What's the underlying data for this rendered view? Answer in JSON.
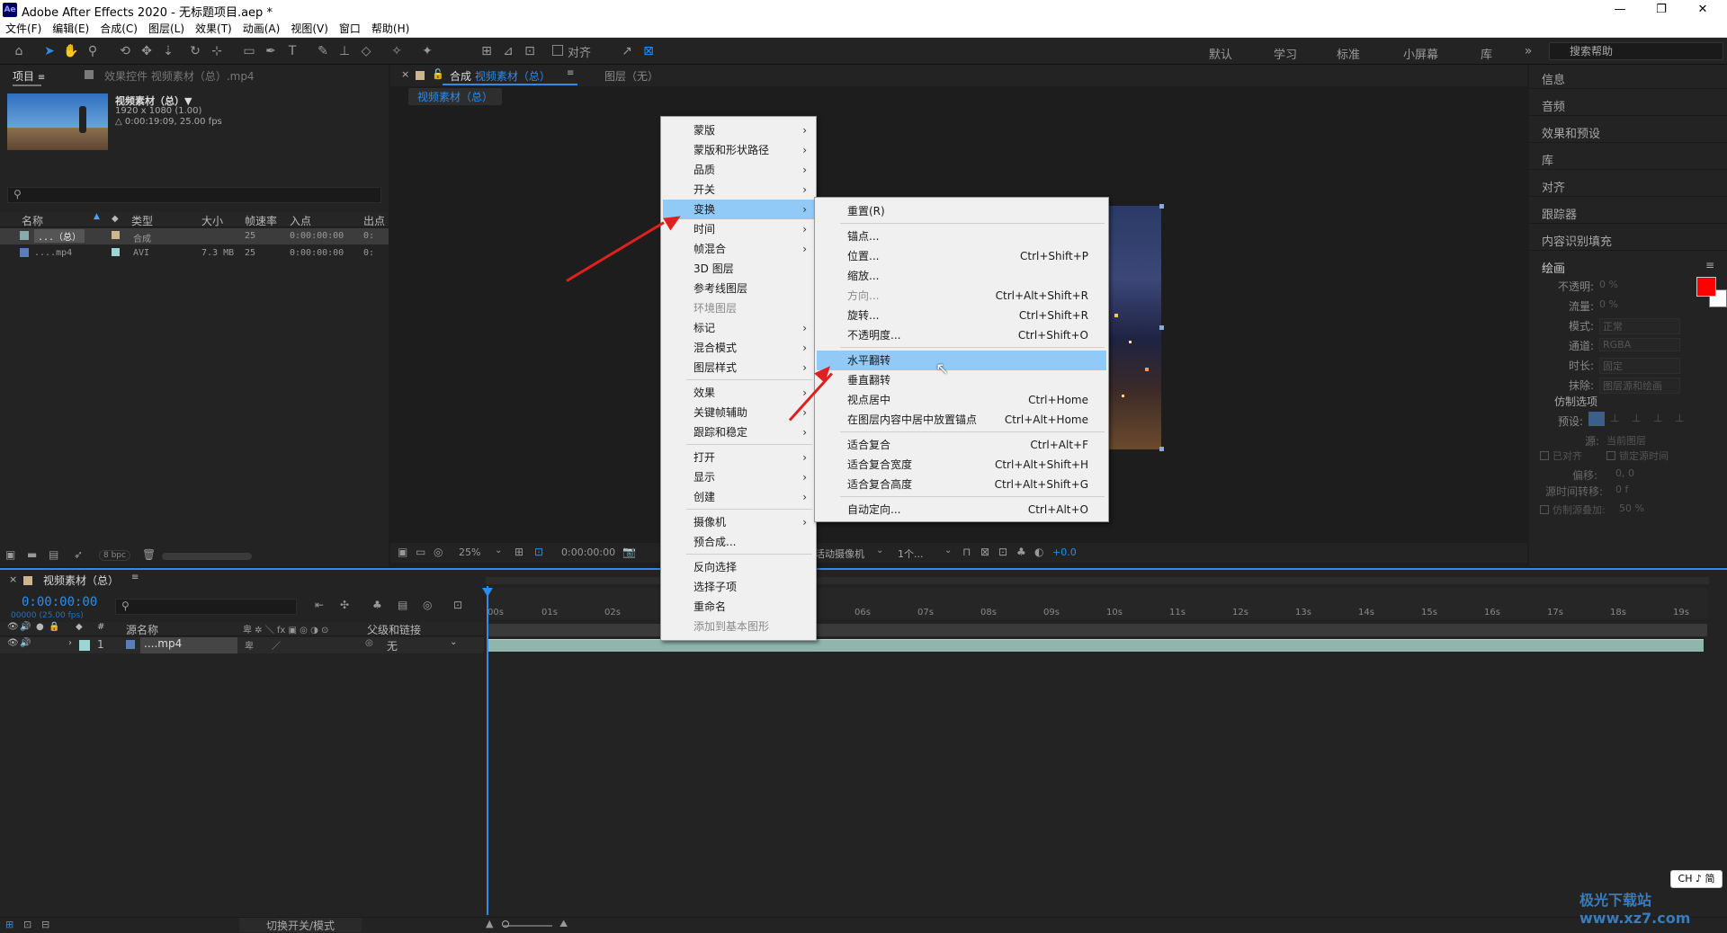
{
  "window": {
    "title": "Adobe After Effects 2020 - 无标题项目.aep *",
    "logo": "Ae"
  },
  "menubar": [
    "文件(F)",
    "编辑(E)",
    "合成(C)",
    "图层(L)",
    "效果(T)",
    "动画(A)",
    "视图(V)",
    "窗口",
    "帮助(H)"
  ],
  "toolbar": {
    "snap_label": "对齐",
    "workspaces": [
      "默认",
      "学习",
      "标准",
      "小屏幕",
      "库"
    ],
    "search_placeholder": "搜索帮助"
  },
  "project_panel": {
    "tab_project": "项目",
    "tab_effects": "效果控件 视频素材（总）.mp4",
    "item_name": "视频素材（总）▼",
    "item_info1": "1920 x 1080 (1.00)",
    "item_info2": "△ 0:00:19:09, 25.00 fps",
    "columns": [
      "名称",
      "类型",
      "大小",
      "帧速率",
      "入点",
      "出点"
    ],
    "rows": [
      {
        "name": "...（总）",
        "type": "合成",
        "size": "",
        "fps": "25",
        "in": "0:00:00:00",
        "out": "0:"
      },
      {
        "name": "....mp4",
        "type": "AVI",
        "size": "7.3 MB",
        "fps": "25",
        "in": "0:00:00:00",
        "out": "0:"
      }
    ],
    "bpc": "8 bpc"
  },
  "comp_panel": {
    "tab_comp": "合成 视频素材（总）",
    "tab_layer": "图层（无）",
    "breadcrumb": "视频素材（总）",
    "zoom": "25%",
    "timecode": "0:00:00:00",
    "camera": "活动摄像机",
    "views": "1个...",
    "exposure": "+0.0"
  },
  "right_panel": {
    "items": [
      "信息",
      "音频",
      "效果和预设",
      "库",
      "对齐",
      "跟踪器",
      "内容识别填充"
    ],
    "paint_title": "绘画",
    "paint_rows": [
      {
        "label": "不透明:",
        "value": "0 %"
      },
      {
        "label": "流量:",
        "value": "0 %"
      },
      {
        "label": "模式:",
        "value": "正常"
      },
      {
        "label": "通道:",
        "value": "RGBA"
      },
      {
        "label": "时长:",
        "value": "固定"
      },
      {
        "label": "抹除:",
        "value": "图层源和绘画"
      }
    ],
    "clone_title": "仿制选项",
    "preset_label": "预设:",
    "source_label": "源:",
    "source_value": "当前图层",
    "aligned": "已对齐",
    "lock_time": "锁定源时间",
    "offset_label": "偏移:",
    "offset_values": "0, 0",
    "time_shift": "源时间转移:",
    "time_shift_value": "0 f",
    "overlay": "仿制源叠加:",
    "overlay_value": "50 %",
    "color_fg": "#ff0000",
    "color_bg": "#ffffff"
  },
  "timeline": {
    "tab": "视频素材（总）",
    "timecode": "0:00:00:00",
    "frame_info": "00000 (25.00 fps)",
    "col_source": "源名称",
    "col_parent": "父级和链接",
    "layer_num": "1",
    "layer_name": "....mp4",
    "parent_value": "无",
    "toggle_label": "切换开关/模式",
    "ruler": [
      "00s",
      "01s",
      "02s",
      "06s",
      "07s",
      "08s",
      "09s",
      "10s",
      "11s",
      "12s",
      "13s",
      "14s",
      "15s",
      "16s",
      "17s",
      "18s",
      "19s"
    ]
  },
  "context_menu": {
    "items": [
      {
        "label": "蒙版",
        "arrow": true
      },
      {
        "label": "蒙版和形状路径",
        "arrow": true
      },
      {
        "label": "品质",
        "arrow": true
      },
      {
        "label": "开关",
        "arrow": true
      },
      {
        "label": "变换",
        "arrow": true,
        "highlight": true
      },
      {
        "label": "时间",
        "arrow": true
      },
      {
        "label": "帧混合",
        "arrow": true
      },
      {
        "label": "3D 图层"
      },
      {
        "label": "参考线图层"
      },
      {
        "label": "环境图层",
        "disabled": true
      },
      {
        "label": "标记",
        "arrow": true
      },
      {
        "label": "混合模式",
        "arrow": true
      },
      {
        "label": "图层样式",
        "arrow": true
      },
      {
        "label": "效果",
        "arrow": true,
        "sep": true
      },
      {
        "label": "关键帧辅助",
        "arrow": true
      },
      {
        "label": "跟踪和稳定",
        "arrow": true
      },
      {
        "label": "打开",
        "arrow": true,
        "sep": true
      },
      {
        "label": "显示",
        "arrow": true
      },
      {
        "label": "创建",
        "arrow": true
      },
      {
        "label": "摄像机",
        "arrow": true,
        "sep": true
      },
      {
        "label": "预合成..."
      },
      {
        "label": "反向选择",
        "sep": true
      },
      {
        "label": "选择子项"
      },
      {
        "label": "重命名"
      },
      {
        "label": "添加到基本图形",
        "disabled": true
      }
    ]
  },
  "submenu": {
    "items": [
      {
        "label": "重置(R)",
        "shortcut": ""
      },
      {
        "label": "锚点...",
        "shortcut": "",
        "sep": true
      },
      {
        "label": "位置...",
        "shortcut": "Ctrl+Shift+P"
      },
      {
        "label": "缩放...",
        "shortcut": ""
      },
      {
        "label": "方向...",
        "shortcut": "Ctrl+Alt+Shift+R",
        "disabled": true
      },
      {
        "label": "旋转...",
        "shortcut": "Ctrl+Shift+R"
      },
      {
        "label": "不透明度...",
        "shortcut": "Ctrl+Shift+O"
      },
      {
        "label": "水平翻转",
        "shortcut": "",
        "highlight": true,
        "sep": true
      },
      {
        "label": "垂直翻转",
        "shortcut": ""
      },
      {
        "label": "视点居中",
        "shortcut": "Ctrl+Home"
      },
      {
        "label": "在图层内容中居中放置锚点",
        "shortcut": "Ctrl+Alt+Home"
      },
      {
        "label": "适合复合",
        "shortcut": "Ctrl+Alt+F",
        "sep": true
      },
      {
        "label": "适合复合宽度",
        "shortcut": "Ctrl+Alt+Shift+H"
      },
      {
        "label": "适合复合高度",
        "shortcut": "Ctrl+Alt+Shift+G"
      },
      {
        "label": "自动定向...",
        "shortcut": "Ctrl+Alt+O",
        "sep": true
      }
    ]
  },
  "ime": "CH ♪ 简",
  "watermark": "极光下载站 www.xz7.com"
}
